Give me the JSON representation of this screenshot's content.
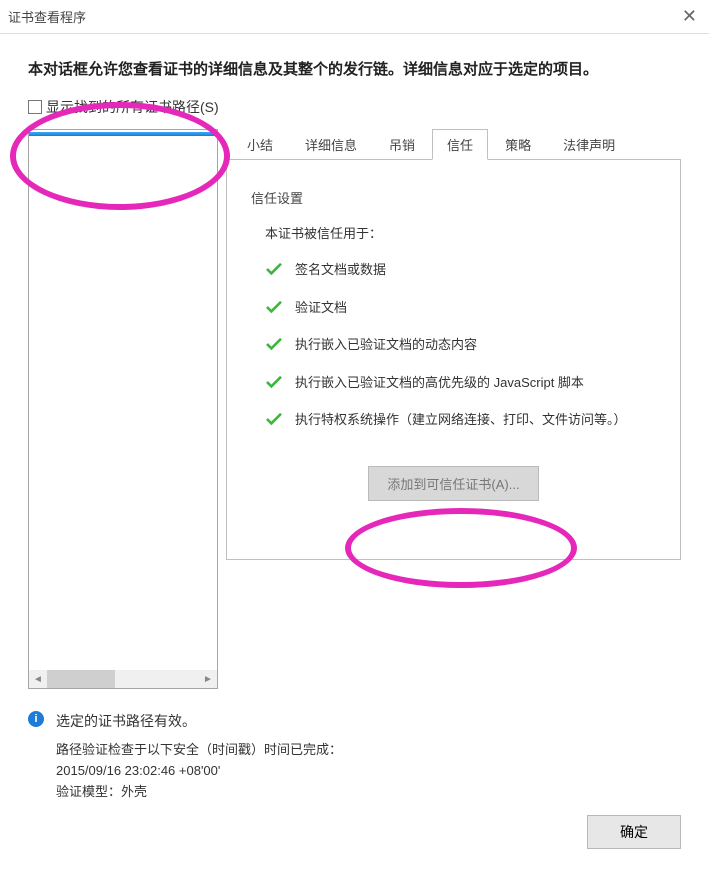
{
  "window": {
    "title": "证书查看程序",
    "close": "✕"
  },
  "description": "本对话框允许您查看证书的详细信息及其整个的发行链。详细信息对应于选定的项目。",
  "checkbox_label": "显示找到的所有证书路径(S)",
  "tree": {
    "root_label": "",
    "sub_label": ""
  },
  "tabs": [
    "小结",
    "详细信息",
    "吊销",
    "信任",
    "策略",
    "法律声明"
  ],
  "selected_tab_index": 3,
  "trust": {
    "section_title": "信任设置",
    "intro": "本证书被信任用于：",
    "items": [
      "签名文档或数据",
      "验证文档",
      "执行嵌入已验证文档的动态内容",
      "执行嵌入已验证文档的高优先级的 JavaScript 脚本",
      "执行特权系统操作（建立网络连接、打印、文件访问等。）"
    ],
    "add_button": "添加到可信任证书(A)..."
  },
  "footer": {
    "status": "选定的证书路径有效。",
    "line1": "路径验证检查于以下安全（时间戳）时间已完成：",
    "line2": "2015/09/16 23:02:46 +08'00'",
    "line3": "验证模型：外壳"
  },
  "ok_button": "确定"
}
